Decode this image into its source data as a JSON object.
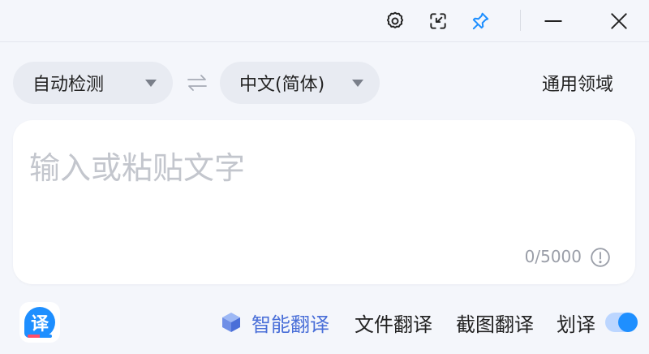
{
  "titlebar": {
    "icons": {
      "settings": "gear-icon",
      "mini_mode": "compress-icon",
      "pin": "pin-icon",
      "minimize": "minimize-icon",
      "close": "close-icon"
    }
  },
  "languages": {
    "source": "自动检测",
    "target": "中文(简体)",
    "swap_icon": "swap-icon",
    "domain": "通用领域"
  },
  "input": {
    "placeholder": "输入或粘贴文字",
    "value": "",
    "counter": "0/5000"
  },
  "bottom": {
    "smart_translate": "智能翻译",
    "file_translate": "文件翻译",
    "screenshot_translate": "截图翻译",
    "selection_translate": "划译",
    "selection_enabled": true,
    "logo_glyph": "译"
  },
  "colors": {
    "accent": "#1e8fff",
    "smart_label": "#4a6fd8",
    "pin_active": "#1e8fff",
    "background": "#f4f6fb"
  }
}
